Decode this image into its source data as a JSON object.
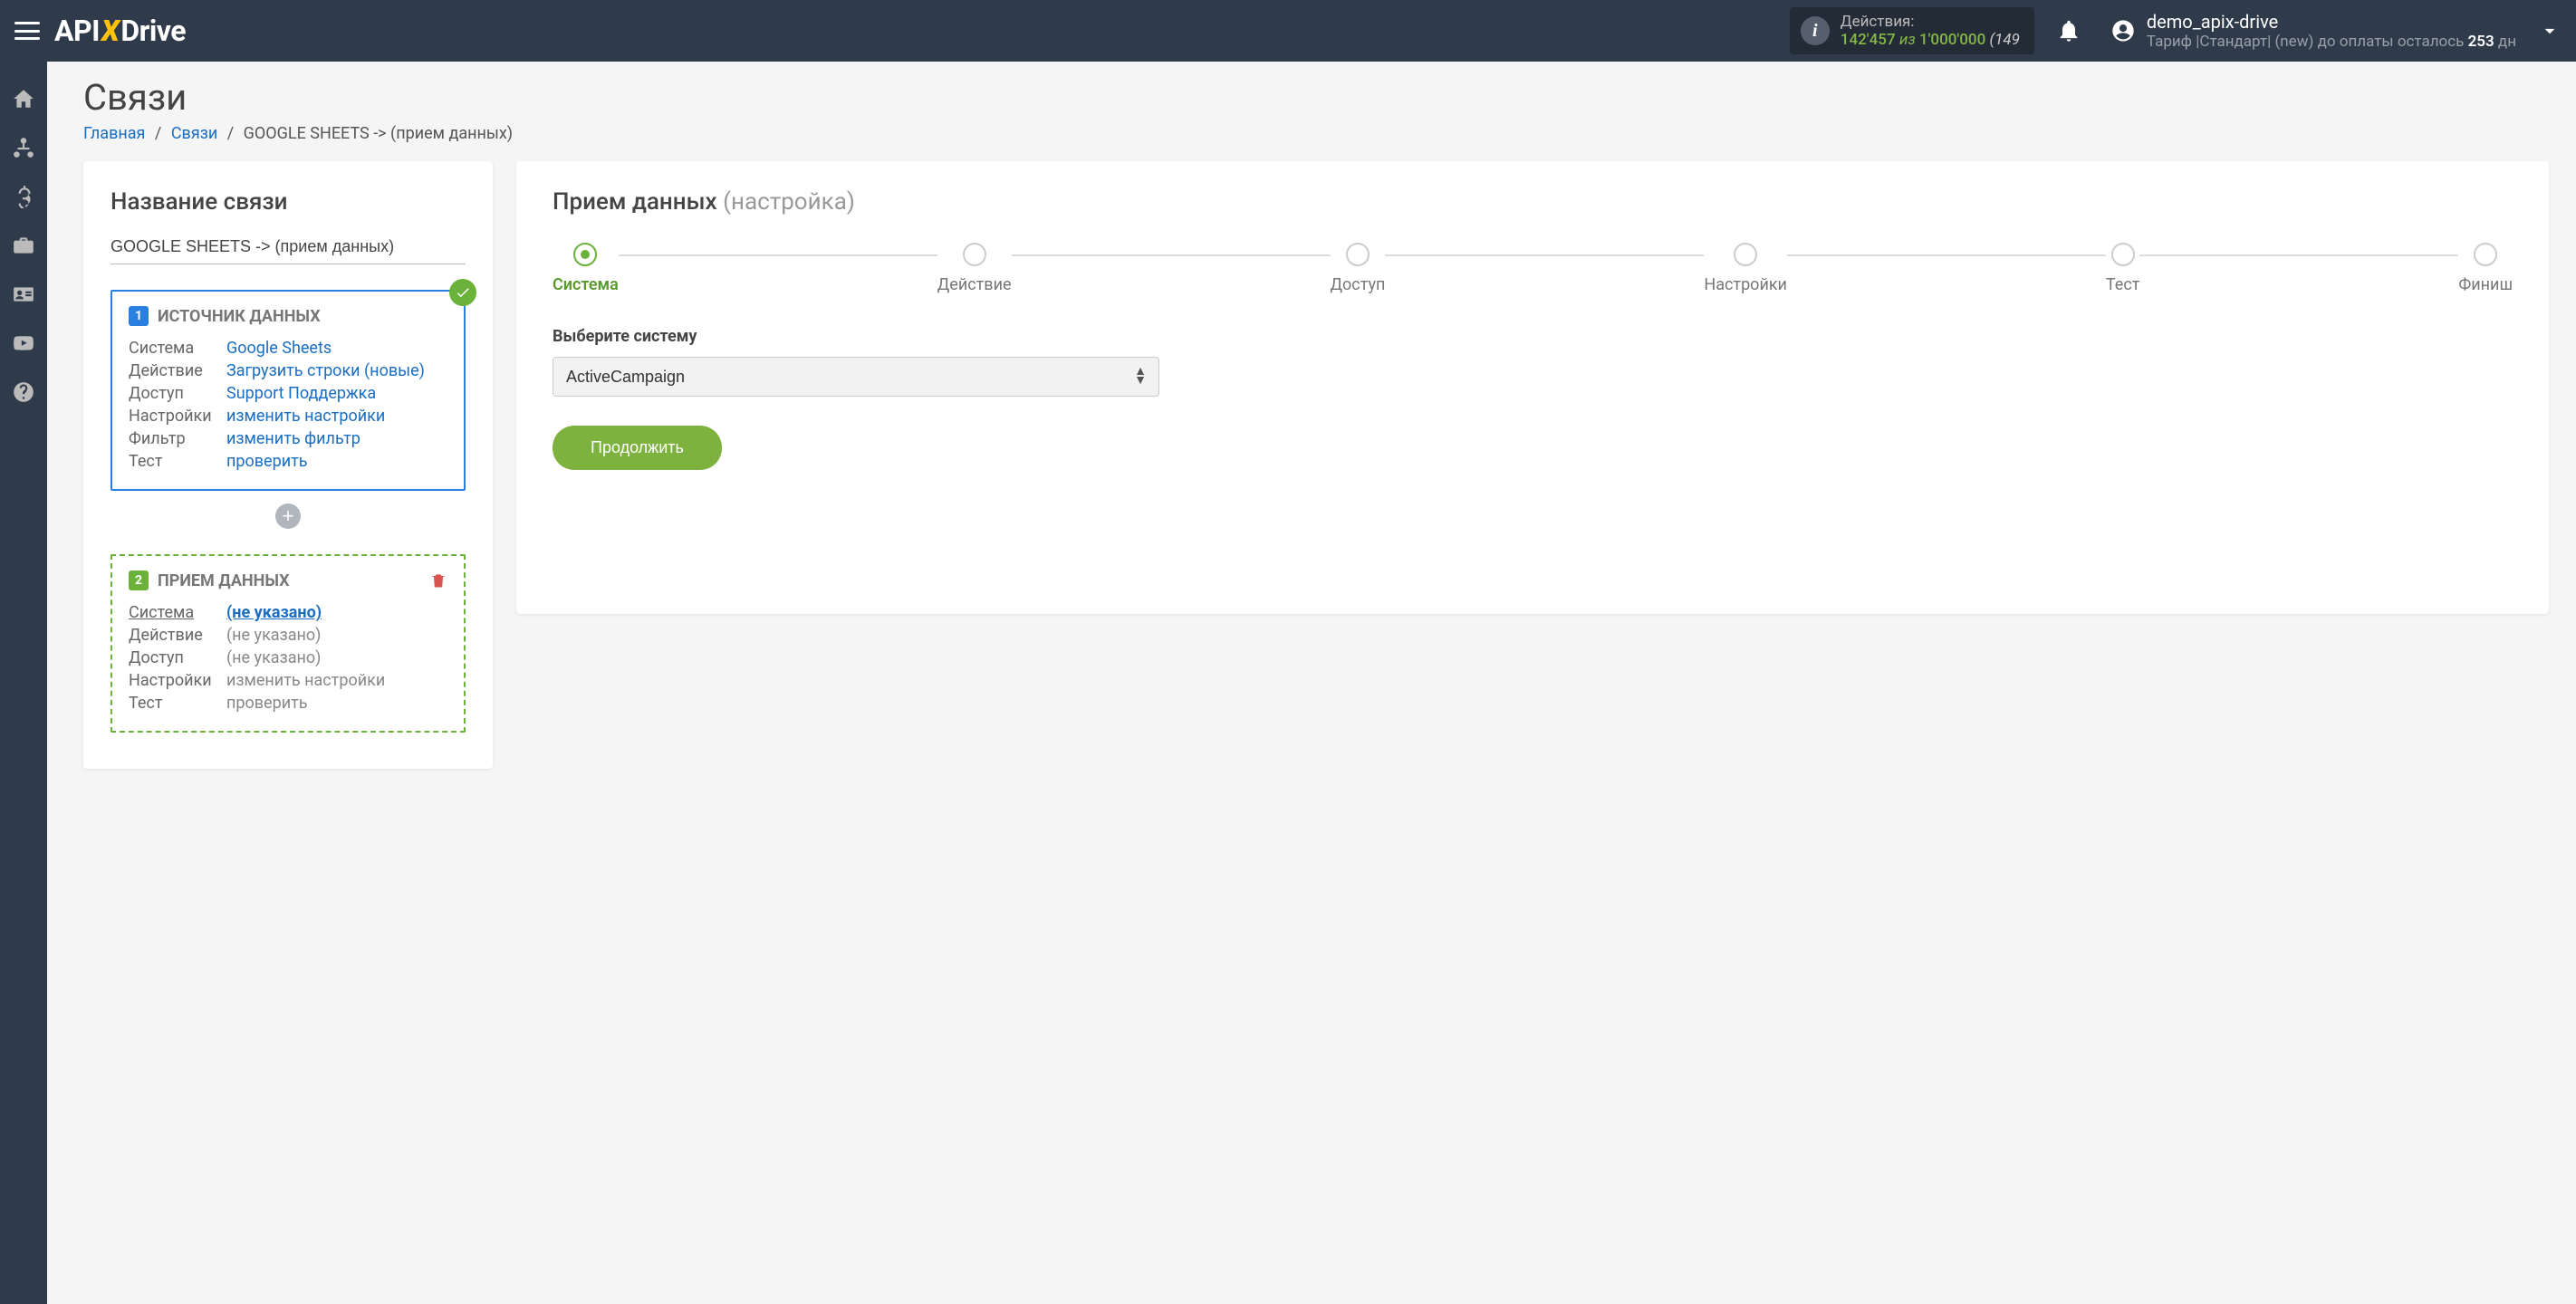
{
  "header": {
    "logo_parts": {
      "api": "API",
      "x": "X",
      "drive": "Drive"
    },
    "actions": {
      "label": "Действия:",
      "used": "142'457",
      "of_word": "из",
      "limit": "1'000'000",
      "tail": "(149"
    },
    "user": {
      "name": "demo_apix-drive",
      "plan_prefix": "Тариф |Стандарт| (new) до оплаты осталось ",
      "days_left": "253",
      "plan_suffix": " дн"
    }
  },
  "sidebar": {
    "items": [
      {
        "name": "home-icon"
      },
      {
        "name": "connections-icon"
      },
      {
        "name": "billing-icon"
      },
      {
        "name": "briefcase-icon"
      },
      {
        "name": "id-card-icon"
      },
      {
        "name": "youtube-icon"
      },
      {
        "name": "help-icon"
      }
    ]
  },
  "page": {
    "title": "Связи",
    "breadcrumb": {
      "home": "Главная",
      "links": "Связи",
      "current": "GOOGLE SHEETS -> (прием данных)"
    }
  },
  "left_panel": {
    "heading": "Название связи",
    "conn_name": "GOOGLE SHEETS -> (прием данных)",
    "source": {
      "num": "1",
      "title": "ИСТОЧНИК ДАННЫХ",
      "rows": {
        "system": {
          "k": "Система",
          "v": "Google Sheets"
        },
        "action": {
          "k": "Действие",
          "v": "Загрузить строки (новые)"
        },
        "access": {
          "k": "Доступ",
          "v": "Support Поддержка"
        },
        "settings": {
          "k": "Настройки",
          "v": "изменить настройки"
        },
        "filter": {
          "k": "Фильтр",
          "v": "изменить фильтр"
        },
        "test": {
          "k": "Тест",
          "v": "проверить"
        }
      }
    },
    "dest": {
      "num": "2",
      "title": "ПРИЕМ ДАННЫХ",
      "rows": {
        "system": {
          "k": "Система",
          "v": "(не указано)"
        },
        "action": {
          "k": "Действие",
          "v": "(не указано)"
        },
        "access": {
          "k": "Доступ",
          "v": "(не указано)"
        },
        "settings": {
          "k": "Настройки",
          "v": "изменить настройки"
        },
        "test": {
          "k": "Тест",
          "v": "проверить"
        }
      }
    }
  },
  "right_panel": {
    "title": "Прием данных",
    "subtitle": "(настройка)",
    "steps": [
      "Система",
      "Действие",
      "Доступ",
      "Настройки",
      "Тест",
      "Финиш"
    ],
    "active_step": 0,
    "select_label": "Выберите систему",
    "select_value": "ActiveCampaign",
    "continue_label": "Продолжить"
  }
}
